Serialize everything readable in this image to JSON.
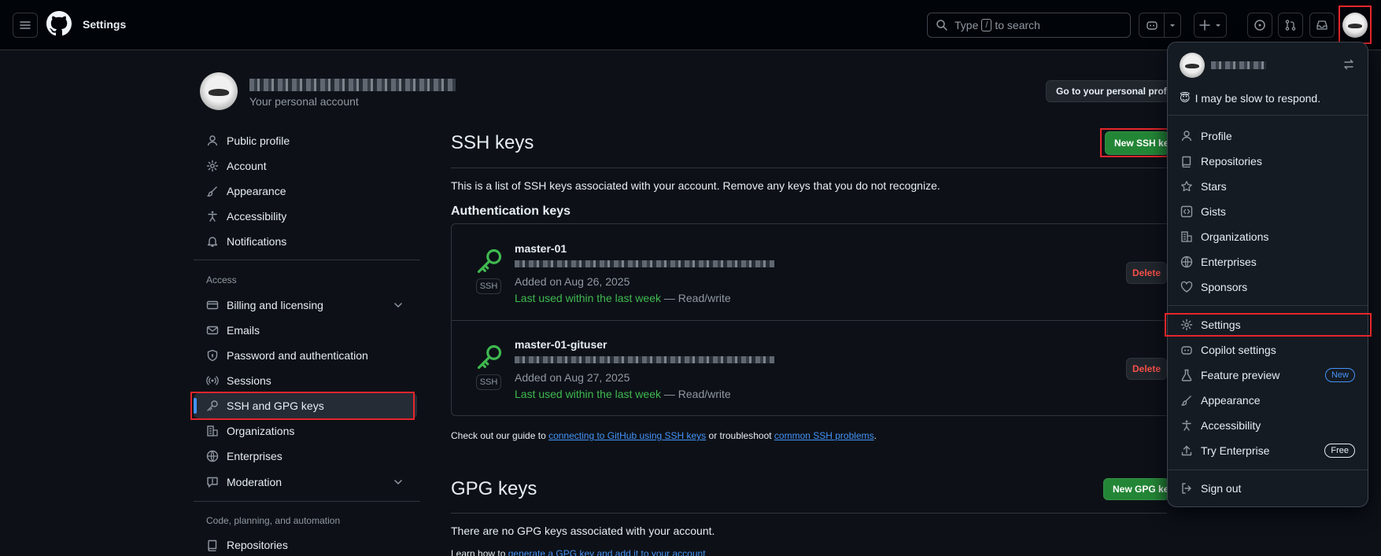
{
  "header": {
    "title": "Settings",
    "search_prefix": "Type",
    "search_key": "/",
    "search_suffix": "to search"
  },
  "profile": {
    "subtitle": "Your personal account",
    "go_profile_button": "Go to your personal profile"
  },
  "sidebar": {
    "items": [
      {
        "label": "Public profile",
        "icon": "person-icon"
      },
      {
        "label": "Account",
        "icon": "gear-icon"
      },
      {
        "label": "Appearance",
        "icon": "paintbrush-icon"
      },
      {
        "label": "Accessibility",
        "icon": "accessibility-icon"
      },
      {
        "label": "Notifications",
        "icon": "bell-icon"
      }
    ],
    "access_label": "Access",
    "access_items": [
      {
        "label": "Billing and licensing",
        "icon": "credit-card-icon"
      },
      {
        "label": "Emails",
        "icon": "mail-icon"
      },
      {
        "label": "Password and authentication",
        "icon": "shield-lock-icon"
      },
      {
        "label": "Sessions",
        "icon": "broadcast-icon"
      },
      {
        "label": "SSH and GPG keys",
        "icon": "key-icon"
      },
      {
        "label": "Organizations",
        "icon": "organization-icon"
      },
      {
        "label": "Enterprises",
        "icon": "globe-icon"
      },
      {
        "label": "Moderation",
        "icon": "report-icon"
      }
    ],
    "code_label": "Code, planning, and automation",
    "code_items": [
      {
        "label": "Repositories",
        "icon": "repo-icon"
      }
    ]
  },
  "main": {
    "ssh_title": "SSH keys",
    "new_ssh_button": "New SSH key",
    "ssh_description": "This is a list of SSH keys associated with your account. Remove any keys that you do not recognize.",
    "auth_keys_title": "Authentication keys",
    "keys": [
      {
        "name": "master-01",
        "added": "Added on Aug 26, 2025",
        "last_used": "Last used within the last week",
        "access": " — Read/write",
        "badge": "SSH",
        "delete": "Delete"
      },
      {
        "name": "master-01-gituser",
        "added": "Added on Aug 27, 2025",
        "last_used": "Last used within the last week",
        "access": " — Read/write",
        "badge": "SSH",
        "delete": "Delete"
      }
    ],
    "guide_prefix": "Check out our guide to ",
    "guide_link1": "connecting to GitHub using SSH keys",
    "guide_middle": " or troubleshoot ",
    "guide_link2": "common SSH problems",
    "guide_suffix": ".",
    "gpg_title": "GPG keys",
    "new_gpg_button": "New GPG key",
    "gpg_description": "There are no GPG keys associated with your account.",
    "gpg_learn_prefix": "Learn how to ",
    "gpg_learn_link": "generate a GPG key and add it to your account"
  },
  "user_menu": {
    "status": "I may be slow to respond.",
    "status_emoji": "😇",
    "items": [
      {
        "label": "Profile",
        "icon": "person-icon"
      },
      {
        "label": "Repositories",
        "icon": "repo-icon"
      },
      {
        "label": "Stars",
        "icon": "star-icon"
      },
      {
        "label": "Gists",
        "icon": "code-square-icon"
      },
      {
        "label": "Organizations",
        "icon": "organization-icon"
      },
      {
        "label": "Enterprises",
        "icon": "globe-icon"
      },
      {
        "label": "Sponsors",
        "icon": "heart-icon"
      }
    ],
    "items2": [
      {
        "label": "Settings",
        "icon": "gear-icon"
      },
      {
        "label": "Copilot settings",
        "icon": "copilot-icon"
      },
      {
        "label": "Feature preview",
        "icon": "beaker-icon",
        "badge": "New"
      },
      {
        "label": "Appearance",
        "icon": "paintbrush-icon"
      },
      {
        "label": "Accessibility",
        "icon": "accessibility-icon"
      },
      {
        "label": "Try Enterprise",
        "icon": "upload-icon",
        "badge": "Free"
      }
    ],
    "sign_out": "Sign out"
  },
  "colors": {
    "accent": "#4493f8",
    "success": "#238636",
    "danger": "#f85149",
    "highlight": "#e5262b"
  }
}
